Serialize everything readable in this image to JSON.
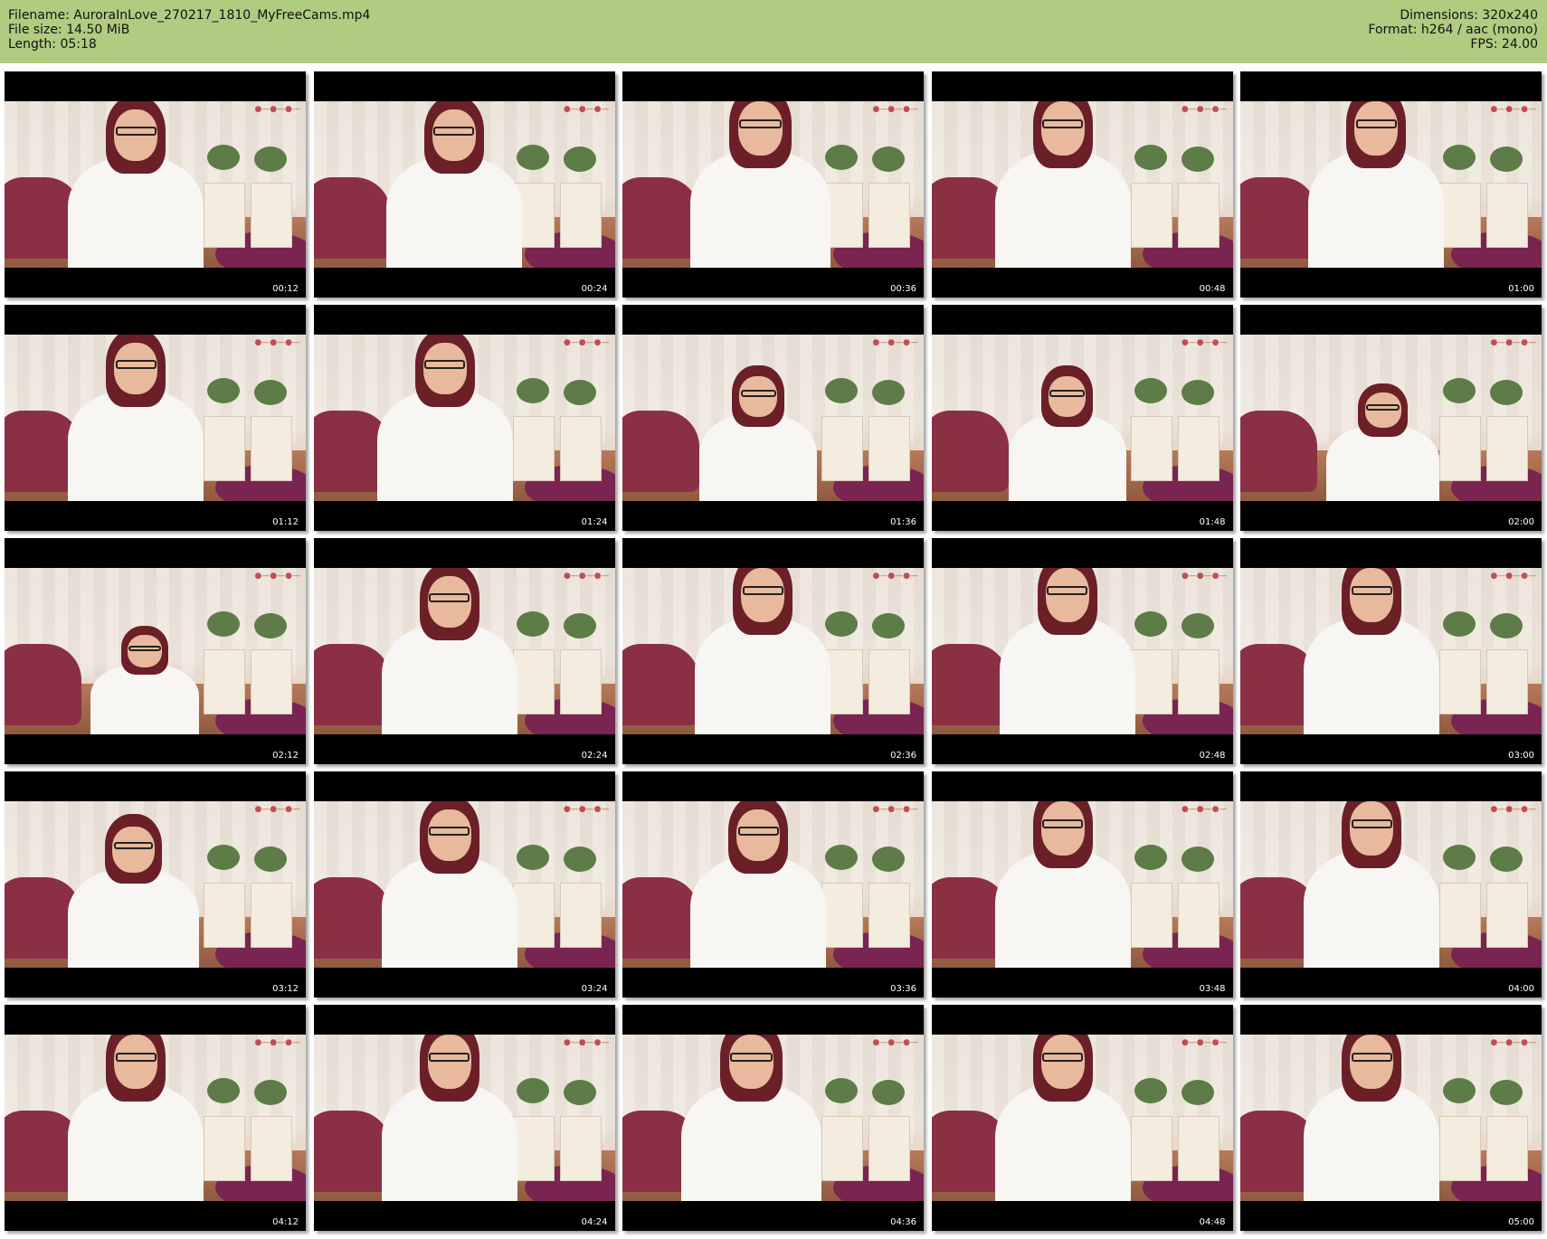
{
  "header": {
    "filename": "Filename: AuroraInLove_270217_1810_MyFreeCams.mp4",
    "file_size": "File size: 14.50 MiB",
    "length": "Length: 05:18",
    "dimensions": "Dimensions: 320x240",
    "format": "Format: h264 / aac (mono)",
    "fps": "FPS: 24.00",
    "background_color": "#b0cc80"
  },
  "thumbnails": [
    {
      "time": "00:12"
    },
    {
      "time": "00:24"
    },
    {
      "time": "00:36"
    },
    {
      "time": "00:48"
    },
    {
      "time": "01:00"
    },
    {
      "time": "01:12"
    },
    {
      "time": "01:24"
    },
    {
      "time": "01:36"
    },
    {
      "time": "01:48"
    },
    {
      "time": "02:00"
    },
    {
      "time": "02:12"
    },
    {
      "time": "02:24"
    },
    {
      "time": "02:36"
    },
    {
      "time": "02:48"
    },
    {
      "time": "03:00"
    },
    {
      "time": "03:12"
    },
    {
      "time": "03:24"
    },
    {
      "time": "03:36"
    },
    {
      "time": "03:48"
    },
    {
      "time": "04:00"
    },
    {
      "time": "04:12"
    },
    {
      "time": "04:24"
    },
    {
      "time": "04:36"
    },
    {
      "time": "04:48"
    },
    {
      "time": "05:00"
    }
  ]
}
